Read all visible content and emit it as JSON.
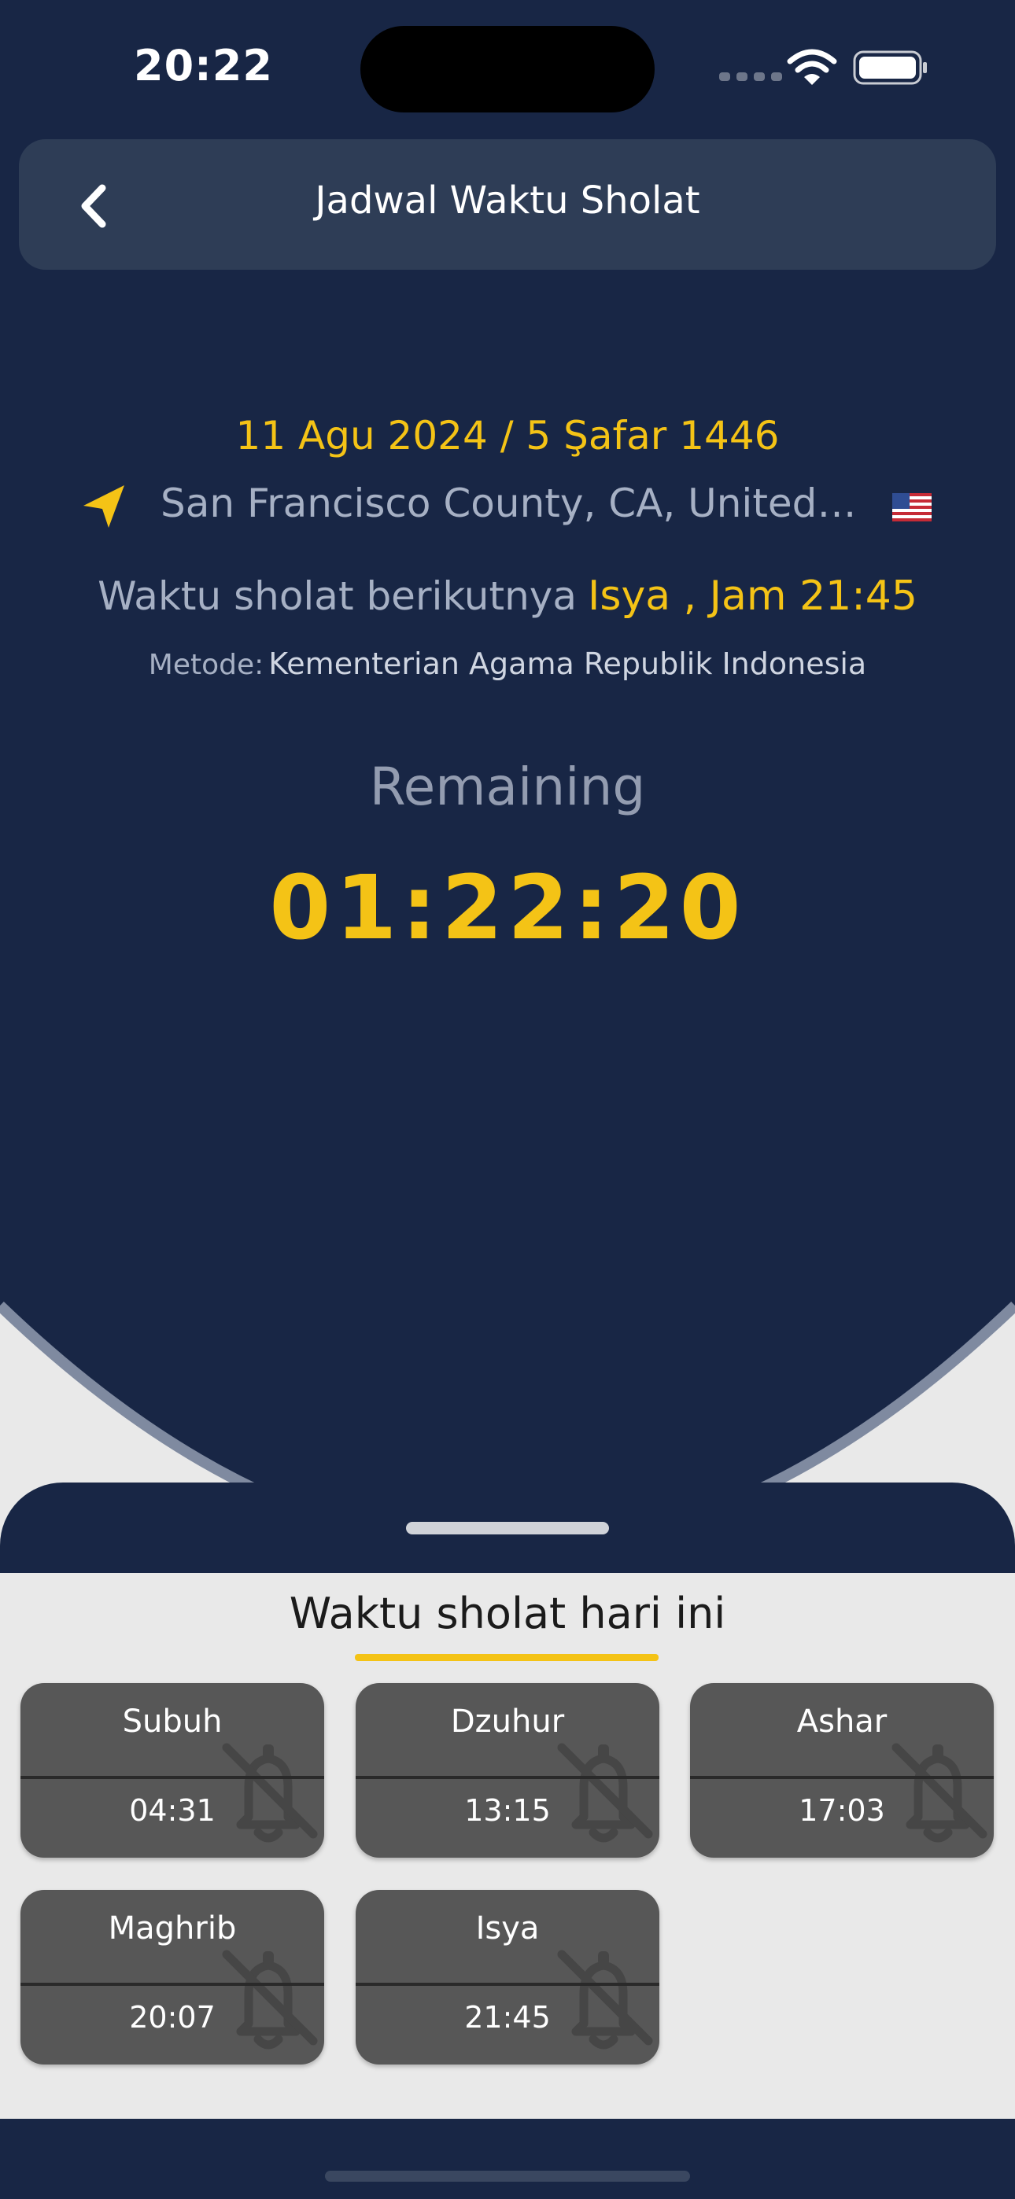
{
  "status_bar": {
    "time": "20:22"
  },
  "header": {
    "title": "Jadwal Waktu Sholat"
  },
  "info": {
    "date": "11 Agu 2024 / 5 Şafar 1446",
    "location": "San Francisco County, CA, United Sta...",
    "flag": "🇺🇸",
    "next_label": "Waktu sholat berikutnya",
    "next_value": "Isya , Jam 21:45",
    "method_label": "Metode:",
    "method_value": "Kementerian Agama Republik Indonesia",
    "remaining_label": "Remaining",
    "countdown": "01:22:20"
  },
  "today": {
    "title": "Waktu sholat hari ini",
    "prayers": [
      {
        "name": "Subuh",
        "time": "04:31",
        "icon": "bell-off-icon"
      },
      {
        "name": "Dzuhur",
        "time": "13:15",
        "icon": "bell-off-icon"
      },
      {
        "name": "Ashar",
        "time": "17:03",
        "icon": "bell-off-icon"
      },
      {
        "name": "Maghrib",
        "time": "20:07",
        "icon": "bell-off-icon"
      },
      {
        "name": "Isya",
        "time": "21:45",
        "icon": "bell-off-icon"
      }
    ]
  },
  "colors": {
    "navy": "#182645",
    "accent_yellow": "#f4c316",
    "card_gray": "#575757",
    "header_card": "#2e3d56"
  }
}
